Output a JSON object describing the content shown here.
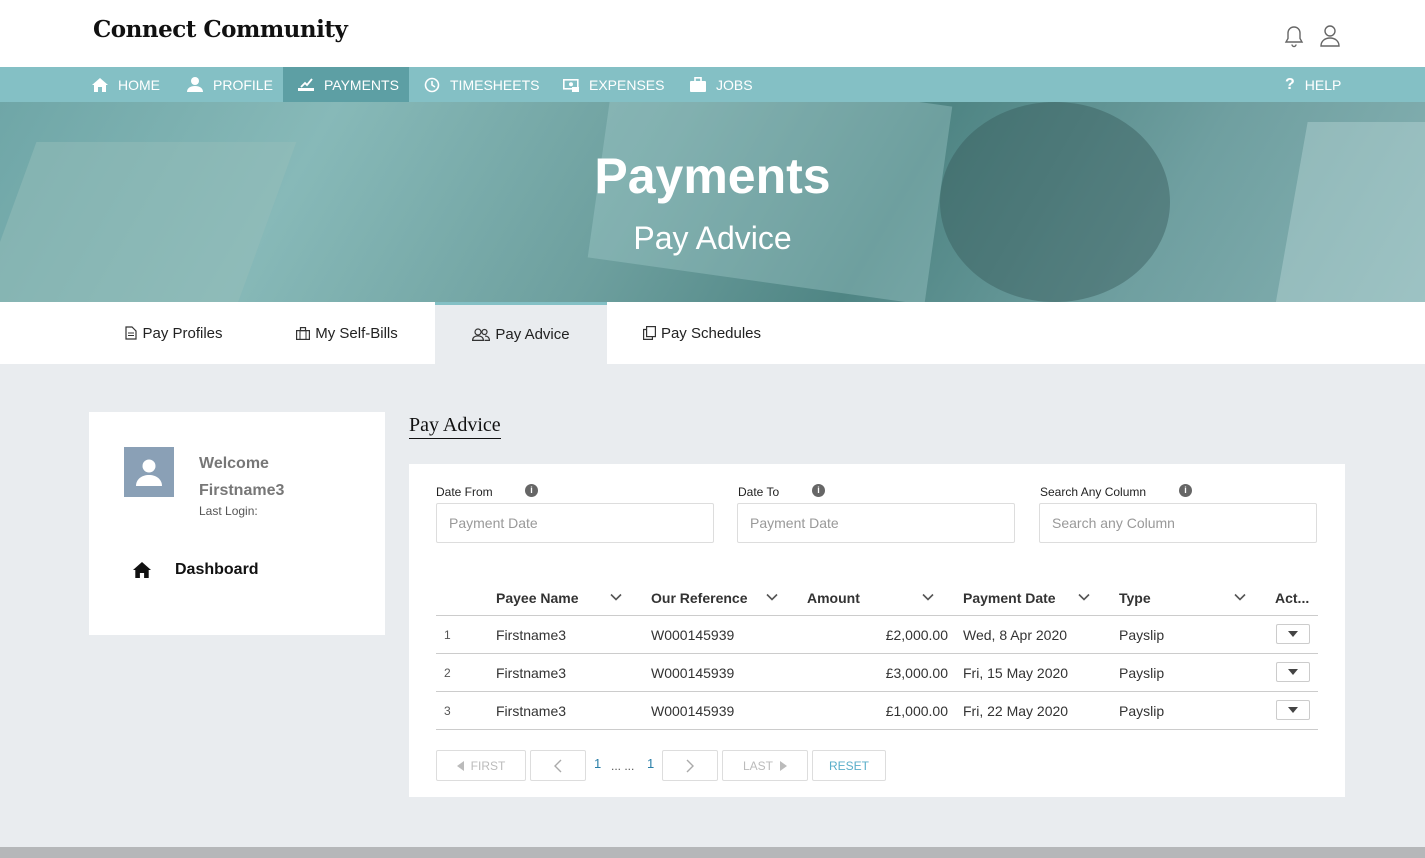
{
  "app": {
    "logo": "Connect Community"
  },
  "topbar": {
    "icons": [
      "bell-icon",
      "user-icon"
    ]
  },
  "nav": {
    "items": [
      {
        "label": "HOME",
        "icon": "home-icon"
      },
      {
        "label": "PROFILE",
        "icon": "user-icon"
      },
      {
        "label": "PAYMENTS",
        "icon": "payments-icon",
        "active": true
      },
      {
        "label": "TIMESHEETS",
        "icon": "clock-icon"
      },
      {
        "label": "EXPENSES",
        "icon": "expenses-icon"
      },
      {
        "label": "JOBS",
        "icon": "briefcase-icon"
      }
    ],
    "help": "HELP"
  },
  "hero": {
    "title": "Payments",
    "subtitle": "Pay Advice"
  },
  "subtabs": [
    {
      "label": "Pay Profiles",
      "icon": "document-icon"
    },
    {
      "label": "My Self-Bills",
      "icon": "briefcase-icon"
    },
    {
      "label": "Pay Advice",
      "icon": "users-icon",
      "active": true
    },
    {
      "label": "Pay Schedules",
      "icon": "copy-icon"
    }
  ],
  "user_card": {
    "welcome": "Welcome",
    "name": "Firstname3",
    "last_login": "Last Login:",
    "dashboard": "Dashboard"
  },
  "content": {
    "title": "Pay Advice",
    "filters": {
      "date_from_label": "Date From",
      "date_from_placeholder": "Payment Date",
      "date_to_label": "Date To",
      "date_to_placeholder": "Payment Date",
      "search_label": "Search Any Column",
      "search_placeholder": "Search any Column",
      "info": "i"
    },
    "table": {
      "headers": [
        "Payee Name",
        "Our Reference",
        "Amount",
        "Payment Date",
        "Type",
        "Act..."
      ],
      "rows": [
        {
          "n": "1",
          "payee": "Firstname3",
          "ref": "W000145939",
          "amount": "£2,000.00",
          "date": "Wed, 8 Apr 2020",
          "type": "Payslip"
        },
        {
          "n": "2",
          "payee": "Firstname3",
          "ref": "W000145939",
          "amount": "£3,000.00",
          "date": "Fri, 15 May 2020",
          "type": "Payslip"
        },
        {
          "n": "3",
          "payee": "Firstname3",
          "ref": "W000145939",
          "amount": "£1,000.00",
          "date": "Fri, 22 May 2020",
          "type": "Payslip"
        }
      ]
    },
    "pagination": {
      "first": "FIRST",
      "last": "LAST",
      "current": "1",
      "dots": "... ...",
      "total": "1",
      "reset": "RESET"
    }
  },
  "colors": {
    "nav": "#84c0c5",
    "nav_active": "#5d9fa4",
    "background": "#e9ecef",
    "link": "#2a7fa8"
  }
}
